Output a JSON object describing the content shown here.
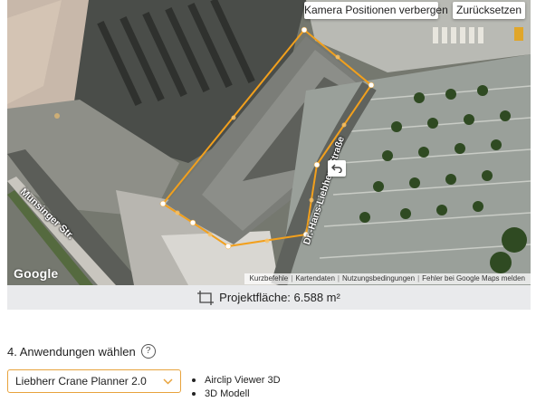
{
  "map": {
    "buttons": {
      "hide_camera": "Kamera Positionen verbergen",
      "reset": "Zurücksetzen"
    },
    "logo": "Google",
    "streets": [
      "Munsinger Str.",
      "Dr.-Hans-Liebherr-Straße"
    ],
    "attribution": [
      "Kurzbefehle",
      "Kartendaten",
      "Nutzungsbedingungen",
      "Fehler bei Google Maps melden"
    ],
    "polygon_color": "#f2a01d"
  },
  "project_area": {
    "label": "Projektfläche: 6.588 m²"
  },
  "applications": {
    "section_title": "4. Anwendungen wählen",
    "help": "?",
    "selected": "Liebherr Crane Planner 2.0",
    "items": [
      "Airclip Viewer 3D",
      "3D Modell"
    ]
  }
}
